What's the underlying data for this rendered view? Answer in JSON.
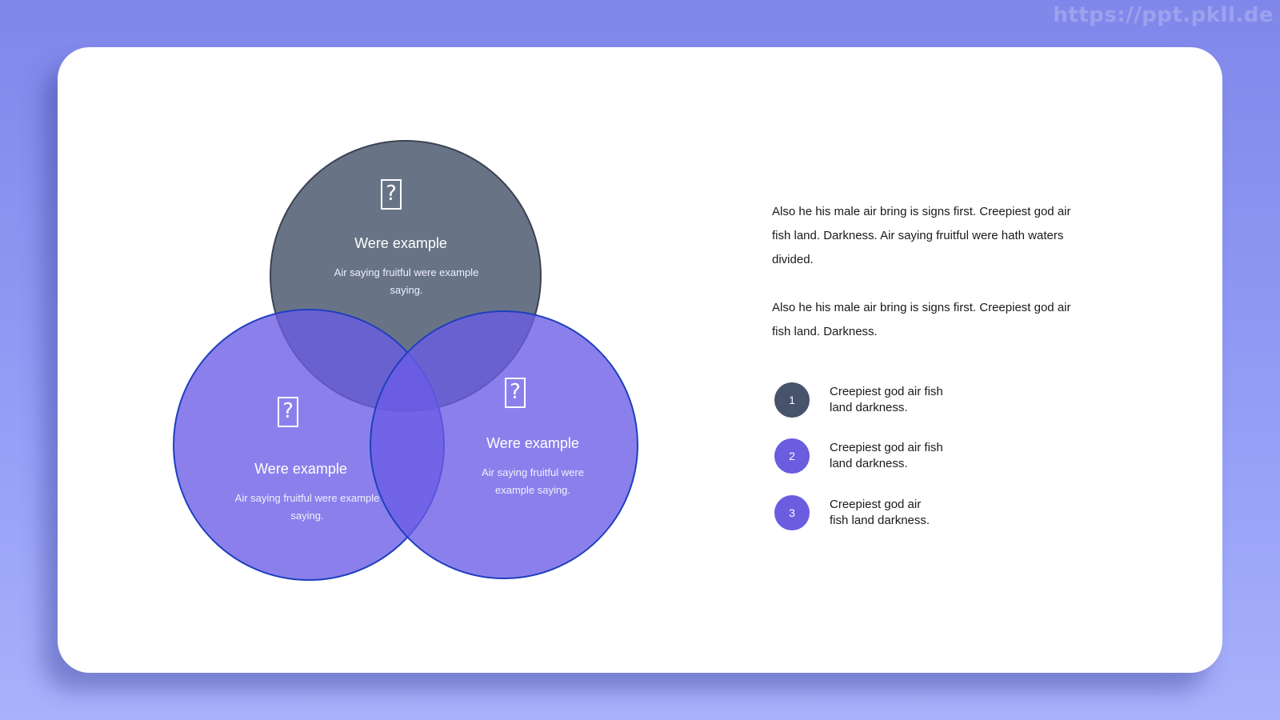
{
  "watermark": "https://ppt.pkll.de",
  "colors": {
    "background_top": "#7f87ea",
    "background_bottom": "#a9b1fb",
    "card": "#ffffff",
    "circle_top": "#586579",
    "circle_purple": "#7264e6",
    "circle_stroke_blue": "#1f3fbf",
    "badge_1": "#46536b",
    "badge_2": "#6b5de0",
    "badge_3": "#6b5de0"
  },
  "venn": {
    "circles": [
      {
        "title": "Were example",
        "description": "Air saying fruitful were example saying.",
        "icon": "question-box-icon"
      },
      {
        "title": "Were example",
        "description": "Air saying fruitful were example saying.",
        "icon": "question-box-icon"
      },
      {
        "title": "Were example",
        "description": "Air saying fruitful were example saying.",
        "icon": "question-box-icon"
      }
    ],
    "icon_glyph": "?"
  },
  "paragraphs": [
    "Also he his male air bring is signs first. Creepiest god air fish land. Darkness. Air saying fruitful were hath waters divided.",
    "Also he his male air bring is signs first. Creepiest god air fish land. Darkness."
  ],
  "list": [
    {
      "number": "1",
      "text": "Creepiest god air fish land darkness."
    },
    {
      "number": "2",
      "text": "Creepiest god air fish land darkness."
    },
    {
      "number": "3",
      "text": "Creepiest god air fish land darkness."
    }
  ]
}
